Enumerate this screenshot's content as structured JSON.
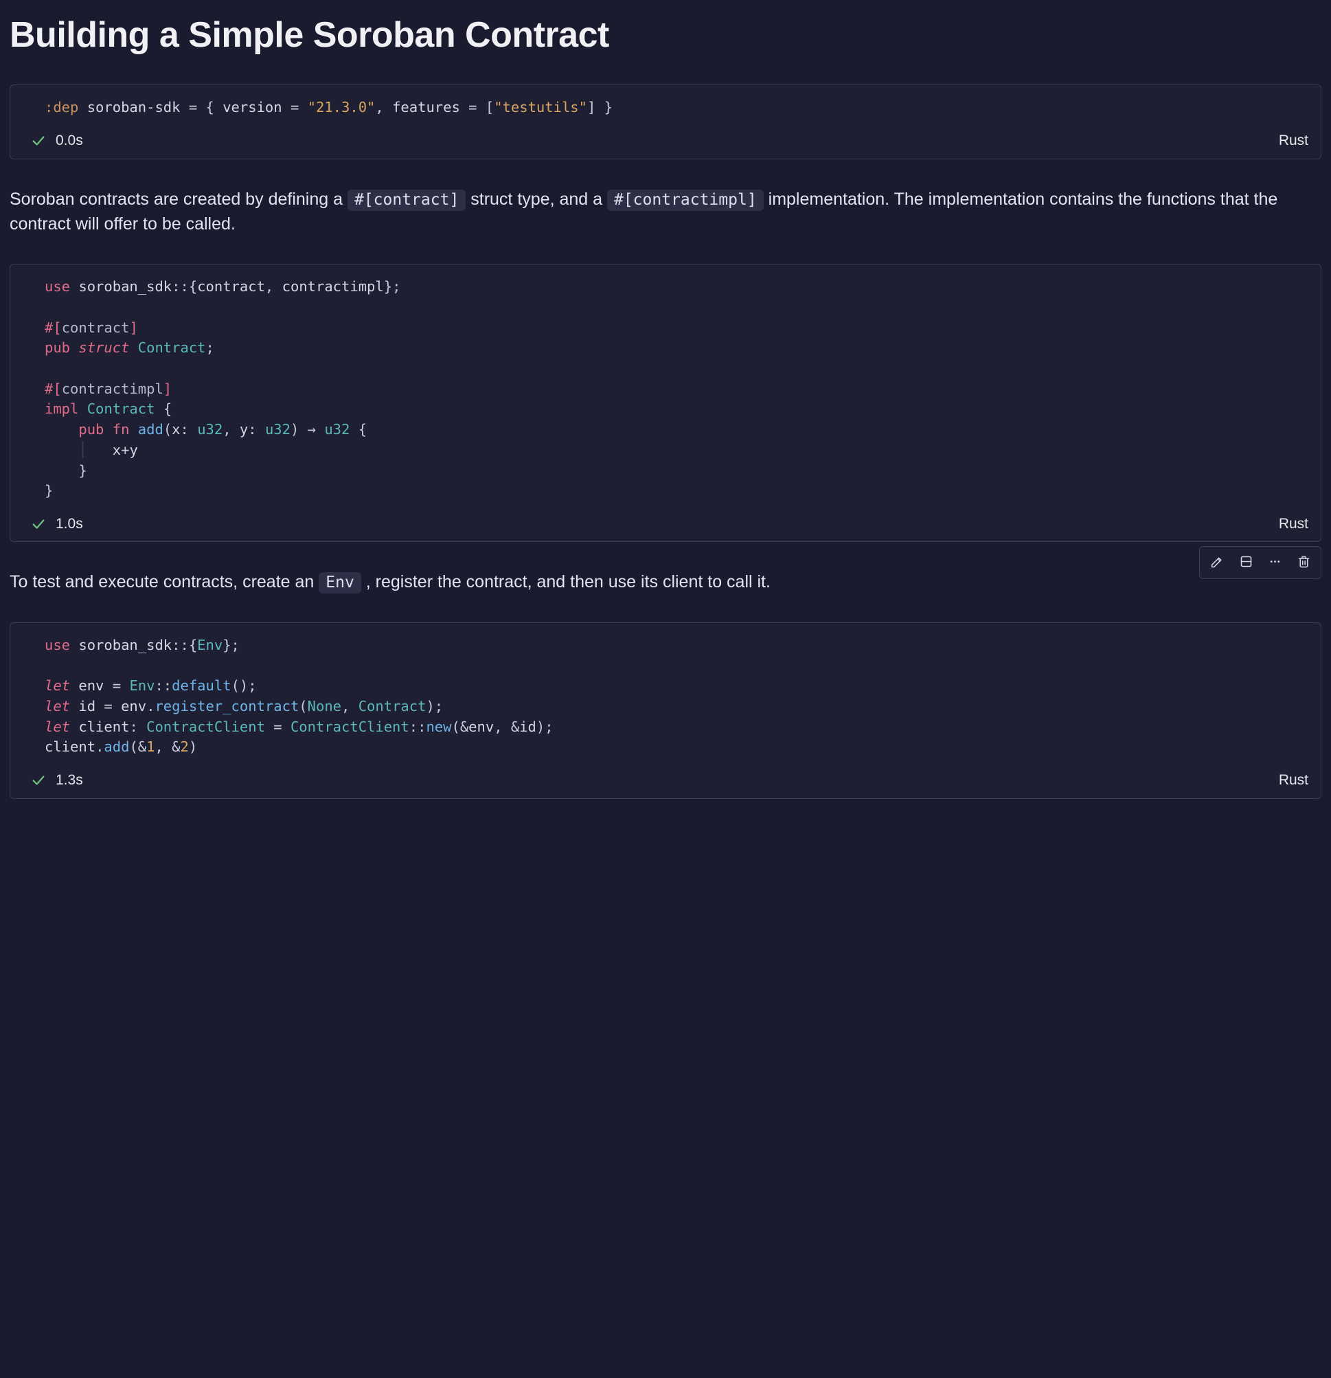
{
  "title": "Building a Simple Soroban Contract",
  "cells": [
    {
      "lang": "Rust",
      "elapsed": "0.0s",
      "status": "ok",
      "code_plain": ":dep soroban-sdk = { version = \"21.3.0\", features = [\"testutils\"] }",
      "tokens": [
        {
          "t": ":dep",
          "c": "meta"
        },
        {
          "t": " ",
          "c": "sp"
        },
        {
          "t": "soroban",
          "c": "id"
        },
        {
          "t": "-",
          "c": "op"
        },
        {
          "t": "sdk",
          "c": "id"
        },
        {
          "t": " = ",
          "c": "op"
        },
        {
          "t": "{",
          "c": "punc"
        },
        {
          "t": " ",
          "c": "sp"
        },
        {
          "t": "version",
          "c": "id"
        },
        {
          "t": " = ",
          "c": "op"
        },
        {
          "t": "\"21.3.0\"",
          "c": "str"
        },
        {
          "t": ",",
          "c": "punc"
        },
        {
          "t": " ",
          "c": "sp"
        },
        {
          "t": "features",
          "c": "id"
        },
        {
          "t": " = ",
          "c": "op"
        },
        {
          "t": "[",
          "c": "punc"
        },
        {
          "t": "\"testutils\"",
          "c": "str"
        },
        {
          "t": "]",
          "c": "punc"
        },
        {
          "t": " ",
          "c": "sp"
        },
        {
          "t": "}",
          "c": "punc"
        }
      ]
    },
    {
      "lang": "Rust",
      "elapsed": "1.0s",
      "status": "ok",
      "code_plain": "use soroban_sdk::{contract, contractimpl};\n\n#[contract]\npub struct Contract;\n\n#[contractimpl]\nimpl Contract {\n    pub fn add(x: u32, y: u32) -> u32 {\n        x+y\n    }\n}",
      "tokens": [
        {
          "t": "use",
          "c": "kw"
        },
        {
          "t": " ",
          "c": "sp"
        },
        {
          "t": "soroban_sdk",
          "c": "id"
        },
        {
          "t": "::",
          "c": "op"
        },
        {
          "t": "{",
          "c": "punc"
        },
        {
          "t": "contract",
          "c": "id"
        },
        {
          "t": ",",
          "c": "punc"
        },
        {
          "t": " ",
          "c": "sp"
        },
        {
          "t": "contractimpl",
          "c": "id"
        },
        {
          "t": "}",
          "c": "punc"
        },
        {
          "t": ";",
          "c": "punc"
        },
        {
          "t": "\n\n",
          "c": "sp"
        },
        {
          "t": "#[",
          "c": "kw"
        },
        {
          "t": "contract",
          "c": "attr"
        },
        {
          "t": "]",
          "c": "kw"
        },
        {
          "t": "\n",
          "c": "sp"
        },
        {
          "t": "pub",
          "c": "kw"
        },
        {
          "t": " ",
          "c": "sp"
        },
        {
          "t": "struct",
          "c": "kw-i"
        },
        {
          "t": " ",
          "c": "sp"
        },
        {
          "t": "Contract",
          "c": "type"
        },
        {
          "t": ";",
          "c": "punc"
        },
        {
          "t": "\n\n",
          "c": "sp"
        },
        {
          "t": "#[",
          "c": "kw"
        },
        {
          "t": "contractimpl",
          "c": "attr"
        },
        {
          "t": "]",
          "c": "kw"
        },
        {
          "t": "\n",
          "c": "sp"
        },
        {
          "t": "impl",
          "c": "kw"
        },
        {
          "t": " ",
          "c": "sp"
        },
        {
          "t": "Contract",
          "c": "type"
        },
        {
          "t": " ",
          "c": "sp"
        },
        {
          "t": "{",
          "c": "punc"
        },
        {
          "t": "\n    ",
          "c": "sp"
        },
        {
          "t": "pub",
          "c": "kw"
        },
        {
          "t": " ",
          "c": "sp"
        },
        {
          "t": "fn",
          "c": "kw"
        },
        {
          "t": " ",
          "c": "sp"
        },
        {
          "t": "add",
          "c": "fn"
        },
        {
          "t": "(",
          "c": "punc"
        },
        {
          "t": "x",
          "c": "id"
        },
        {
          "t": ":",
          "c": "punc"
        },
        {
          "t": " ",
          "c": "sp"
        },
        {
          "t": "u32",
          "c": "type"
        },
        {
          "t": ",",
          "c": "punc"
        },
        {
          "t": " ",
          "c": "sp"
        },
        {
          "t": "y",
          "c": "id"
        },
        {
          "t": ":",
          "c": "punc"
        },
        {
          "t": " ",
          "c": "sp"
        },
        {
          "t": "u32",
          "c": "type"
        },
        {
          "t": ")",
          "c": "punc"
        },
        {
          "t": " → ",
          "c": "op"
        },
        {
          "t": "u32",
          "c": "type"
        },
        {
          "t": " ",
          "c": "sp"
        },
        {
          "t": "{",
          "c": "punc"
        },
        {
          "t": "\n",
          "c": "sp"
        },
        {
          "t": "    │   ",
          "c": "guide"
        },
        {
          "t": "x",
          "c": "id"
        },
        {
          "t": "+",
          "c": "op"
        },
        {
          "t": "y",
          "c": "id"
        },
        {
          "t": "\n",
          "c": "sp"
        },
        {
          "t": "    ",
          "c": "sp"
        },
        {
          "t": "}",
          "c": "punc"
        },
        {
          "t": "\n",
          "c": "sp"
        },
        {
          "t": "}",
          "c": "punc"
        }
      ]
    },
    {
      "lang": "Rust",
      "elapsed": "1.3s",
      "status": "ok",
      "code_plain": "use soroban_sdk::{Env};\n\nlet env = Env::default();\nlet id = env.register_contract(None, Contract);\nlet client: ContractClient = ContractClient::new(&env, &id);\nclient.add(&1, &2)",
      "tokens": [
        {
          "t": "use",
          "c": "kw"
        },
        {
          "t": " ",
          "c": "sp"
        },
        {
          "t": "soroban_sdk",
          "c": "id"
        },
        {
          "t": "::",
          "c": "op"
        },
        {
          "t": "{",
          "c": "punc"
        },
        {
          "t": "Env",
          "c": "type"
        },
        {
          "t": "}",
          "c": "punc"
        },
        {
          "t": ";",
          "c": "punc"
        },
        {
          "t": "\n\n",
          "c": "sp"
        },
        {
          "t": "let",
          "c": "kw-i"
        },
        {
          "t": " ",
          "c": "sp"
        },
        {
          "t": "env",
          "c": "id"
        },
        {
          "t": " = ",
          "c": "op"
        },
        {
          "t": "Env",
          "c": "type"
        },
        {
          "t": "::",
          "c": "op"
        },
        {
          "t": "default",
          "c": "fn"
        },
        {
          "t": "()",
          "c": "punc"
        },
        {
          "t": ";",
          "c": "punc"
        },
        {
          "t": "\n",
          "c": "sp"
        },
        {
          "t": "let",
          "c": "kw-i"
        },
        {
          "t": " ",
          "c": "sp"
        },
        {
          "t": "id",
          "c": "id"
        },
        {
          "t": " = ",
          "c": "op"
        },
        {
          "t": "env",
          "c": "id"
        },
        {
          "t": ".",
          "c": "op"
        },
        {
          "t": "register_contract",
          "c": "fn"
        },
        {
          "t": "(",
          "c": "punc"
        },
        {
          "t": "None",
          "c": "type"
        },
        {
          "t": ",",
          "c": "punc"
        },
        {
          "t": " ",
          "c": "sp"
        },
        {
          "t": "Contract",
          "c": "type"
        },
        {
          "t": ")",
          "c": "punc"
        },
        {
          "t": ";",
          "c": "punc"
        },
        {
          "t": "\n",
          "c": "sp"
        },
        {
          "t": "let",
          "c": "kw-i"
        },
        {
          "t": " ",
          "c": "sp"
        },
        {
          "t": "client",
          "c": "id"
        },
        {
          "t": ":",
          "c": "punc"
        },
        {
          "t": " ",
          "c": "sp"
        },
        {
          "t": "ContractClient",
          "c": "type"
        },
        {
          "t": " = ",
          "c": "op"
        },
        {
          "t": "ContractClient",
          "c": "type"
        },
        {
          "t": "::",
          "c": "op"
        },
        {
          "t": "new",
          "c": "fn"
        },
        {
          "t": "(",
          "c": "punc"
        },
        {
          "t": "&",
          "c": "op"
        },
        {
          "t": "env",
          "c": "id"
        },
        {
          "t": ",",
          "c": "punc"
        },
        {
          "t": " ",
          "c": "sp"
        },
        {
          "t": "&",
          "c": "op"
        },
        {
          "t": "id",
          "c": "id"
        },
        {
          "t": ")",
          "c": "punc"
        },
        {
          "t": ";",
          "c": "punc"
        },
        {
          "t": "\n",
          "c": "sp"
        },
        {
          "t": "client",
          "c": "id"
        },
        {
          "t": ".",
          "c": "op"
        },
        {
          "t": "add",
          "c": "fn"
        },
        {
          "t": "(",
          "c": "punc"
        },
        {
          "t": "&",
          "c": "op"
        },
        {
          "t": "1",
          "c": "num"
        },
        {
          "t": ",",
          "c": "punc"
        },
        {
          "t": " ",
          "c": "sp"
        },
        {
          "t": "&",
          "c": "op"
        },
        {
          "t": "2",
          "c": "num"
        },
        {
          "t": ")",
          "c": "punc"
        }
      ]
    }
  ],
  "prose1": {
    "pre": "Soroban contracts are created by defining a ",
    "code1": "#[contract]",
    "mid1": " struct type, and a ",
    "code2": "#[contractimpl]",
    "post": " implementation. The implementation contains the functions that the contract will offer to be called."
  },
  "prose2": {
    "pre": "To test and execute contracts, create an ",
    "code1": "Env",
    "post": ", register the contract, and then use its client to call it."
  },
  "toolbar": {
    "edit": "Edit",
    "split": "Split cell",
    "more": "More",
    "delete": "Delete"
  }
}
